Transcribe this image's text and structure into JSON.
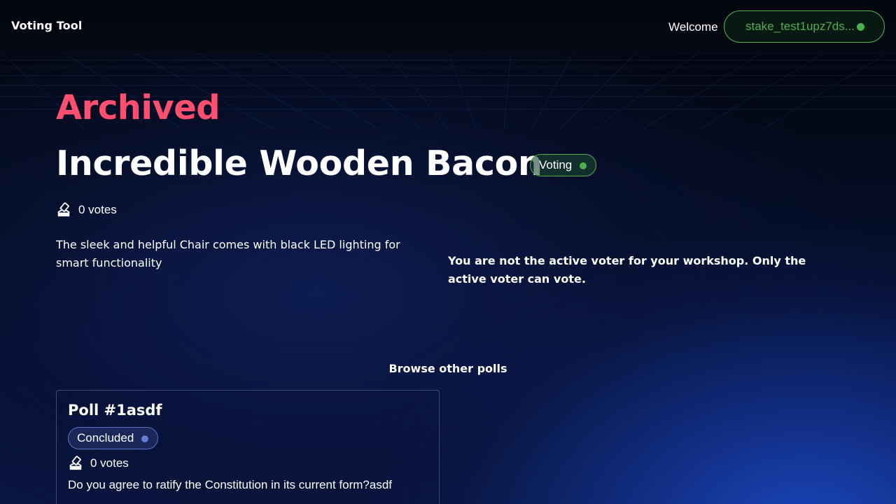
{
  "header": {
    "app_title": "Voting Tool",
    "welcome": "Welcome",
    "wallet_address": "stake_test1upz7ds...",
    "wallet_status_color": "#4caf50"
  },
  "poll": {
    "archived_label": "Archived",
    "title": "Incredible Wooden Bacon",
    "status": "Voting",
    "status_color": "#4caf50",
    "votes": "0 votes",
    "description": "The sleek and helpful Chair comes with black LED lighting for smart functionality",
    "voter_notice": "You are not the active voter for your workshop. Only the active voter can vote."
  },
  "browse": {
    "heading": "Browse other polls",
    "polls": [
      {
        "title": "Poll #1asdf",
        "status": "Concluded",
        "status_color": "#5f7dd6",
        "votes": "0 votes",
        "question": "Do you agree to ratify the Constitution in its current form?asdf"
      }
    ]
  },
  "colors": {
    "accent_archived": "#ff4f70",
    "accent_green": "#4caf50"
  },
  "icons": {
    "votes": "ballot-box-icon",
    "status": "status-dot-icon"
  }
}
